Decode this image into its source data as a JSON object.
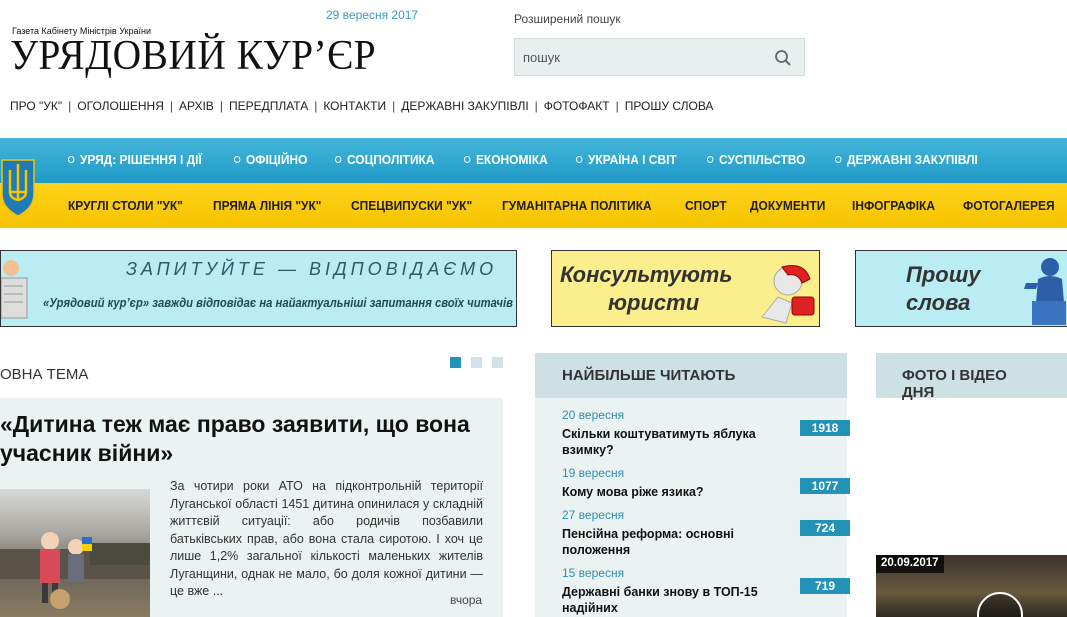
{
  "header": {
    "logo_subtitle": "Газета Кабінету Міністрів України",
    "logo_title": "УРЯДОВИЙ КУР’ЄР",
    "date": "29 вересня 2017",
    "advanced_search": "Розширений пошук",
    "search_placeholder": "пошук",
    "top_nav": [
      "ПРО \"УК\"",
      "ОГОЛОШЕННЯ",
      "АРХІВ",
      "ПЕРЕДПЛАТА",
      "КОНТАКТИ",
      "ДЕРЖАВНІ ЗАКУПІВЛІ",
      "ФОТОФАКТ",
      "ПРОШУ СЛОВА"
    ]
  },
  "menu_blue": [
    "УРЯД: РІШЕННЯ І ДІЇ",
    "ОФІЦІЙНО",
    "СОЦПОЛІТИКА",
    "ЕКОНОМІКА",
    "УКРАЇНА І СВІТ",
    "СУСПІЛЬСТВО",
    "ДЕРЖАВНІ ЗАКУПІВЛІ"
  ],
  "menu_yellow": [
    "КРУГЛІ СТОЛИ \"УК\"",
    "ПРЯМА ЛІНІЯ \"УК\"",
    "СПЕЦВИПУСКИ \"УК\"",
    "ГУМАНІТАРНА ПОЛІТИКА",
    "СПОРТ",
    "ДОКУМЕНТИ",
    "ІНФОГРАФІКА",
    "ФОТОГАЛЕРЕЯ"
  ],
  "banners": {
    "ask": {
      "heading": "ЗАПИТУЙТЕ — ВІДПОВІДАЄМО",
      "sub": "«Урядовий кур’єр» завжди відповідає на найактуальніші запитання своїх читачів"
    },
    "lawyers": {
      "line1": "Консультують",
      "line2": "юристи"
    },
    "speak": {
      "line1": "Прошу",
      "line2": "слова"
    }
  },
  "main_topic": {
    "section_title": "ОВНА ТЕМА",
    "headline": "«Дитина теж має право заявити, що вона учасник війни»",
    "body": "За чотири роки АТО на підконтрольній території Луганської області 1451 дитина опинилася у складній життєвій ситуації: або родичів позбавили батьківських прав, або вона стала сиротою. І хоч це лише 1,2% загальної кількості маленьких жителів Луганщини, однак не мало, бо доля кожної дитини — це вже ...",
    "date": "вчора"
  },
  "most_read": {
    "title": "НАЙБІЛЬШЕ ЧИТАЮТЬ",
    "items": [
      {
        "date": "20 вересня",
        "title": "Скільки коштуватимуть яблука взимку?",
        "count": "1918"
      },
      {
        "date": "19 вересня",
        "title": "Кому мова ріже язика?",
        "count": "1077"
      },
      {
        "date": "27 вересня",
        "title": "Пенсійна реформа: основні положення",
        "count": "724"
      },
      {
        "date": "15 вересня",
        "title": "Державні банки знову в ТОП-15 надійних",
        "count": "719"
      }
    ]
  },
  "photo_video": {
    "title": "ФОТО І ВІДЕО ДНЯ",
    "thumb_date": "20.09.2017"
  },
  "colors": {
    "blue_menu": "#30a7cf",
    "yellow_menu": "#f6c300",
    "accent": "#2293b7",
    "panel_bg": "#eaf3f2"
  }
}
